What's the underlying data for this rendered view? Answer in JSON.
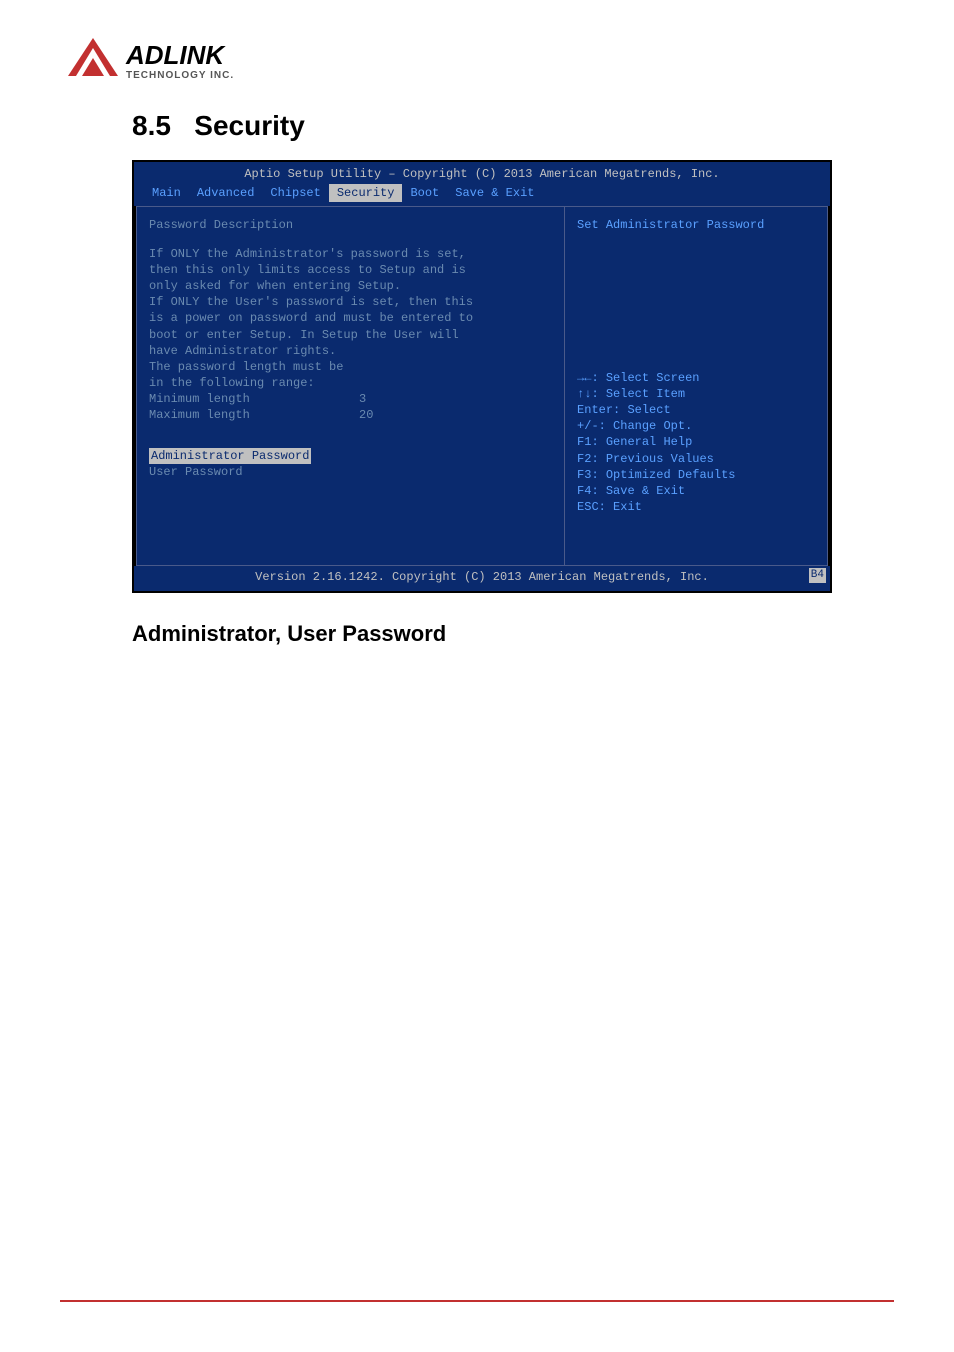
{
  "logo": {
    "name": "ADLINK",
    "sub": "TECHNOLOGY INC."
  },
  "section": {
    "number": "8.5",
    "title": "Security"
  },
  "bios": {
    "title": "Aptio Setup Utility – Copyright (C) 2013 American Megatrends, Inc.",
    "tabs": [
      "Main",
      "Advanced",
      "Chipset",
      "Security",
      "Boot",
      "Save & Exit"
    ],
    "active_tab": "Security",
    "left": {
      "heading": "Password Description",
      "lines": [
        "If ONLY the Administrator's password is set,",
        "then this only limits access to Setup and is",
        "only asked for when entering Setup.",
        "If ONLY the User's password is set, then this",
        "is a power on password and must be entered to",
        "boot or enter Setup. In Setup the User will",
        "have Administrator rights.",
        "The password length must be",
        "in the following range:"
      ],
      "min_label": "Minimum length",
      "min_value": "3",
      "max_label": "Maximum length",
      "max_value": "20",
      "selected_item": "Administrator Password",
      "items": [
        "User Password"
      ]
    },
    "right": {
      "help": "Set Administrator Password",
      "keys": [
        "→←: Select Screen",
        "↑↓: Select Item",
        "Enter: Select",
        "+/-: Change Opt.",
        "F1: General Help",
        "F2: Previous Values",
        "F3: Optimized Defaults",
        "F4: Save & Exit",
        "ESC: Exit"
      ]
    },
    "footer": "Version 2.16.1242. Copyright (C) 2013 American Megatrends, Inc.",
    "footer_badge": "B4"
  },
  "subheading": "Administrator, User Password"
}
